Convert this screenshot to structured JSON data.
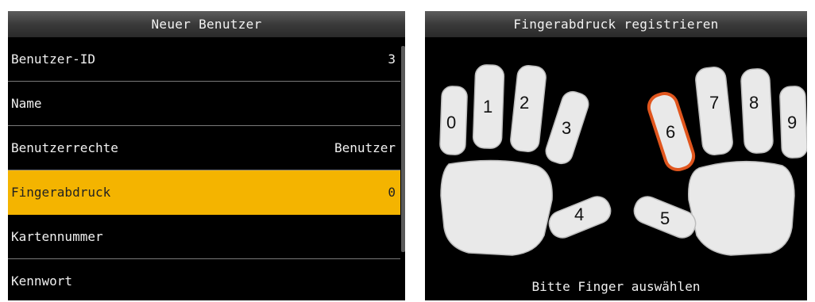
{
  "left_panel": {
    "title": "Neuer Benutzer",
    "rows": [
      {
        "label": "Benutzer-ID",
        "value": "3"
      },
      {
        "label": "Name",
        "value": ""
      },
      {
        "label": "Benutzerrechte",
        "value": "Benutzer"
      },
      {
        "label": "Fingerabdruck",
        "value": "0"
      },
      {
        "label": "Kartennummer",
        "value": ""
      },
      {
        "label": "Kennwort",
        "value": ""
      }
    ],
    "selected_row": "Fingerabdruck"
  },
  "right_panel": {
    "title": "Fingerabdruck registrieren",
    "fingers": [
      "0",
      "1",
      "2",
      "3",
      "4",
      "5",
      "6",
      "7",
      "8",
      "9"
    ],
    "selected_finger": "6",
    "instruction": "Bitte Finger auswählen"
  },
  "colors": {
    "selection_bg": "#f4b400",
    "selection_outline": "#e0561e"
  }
}
